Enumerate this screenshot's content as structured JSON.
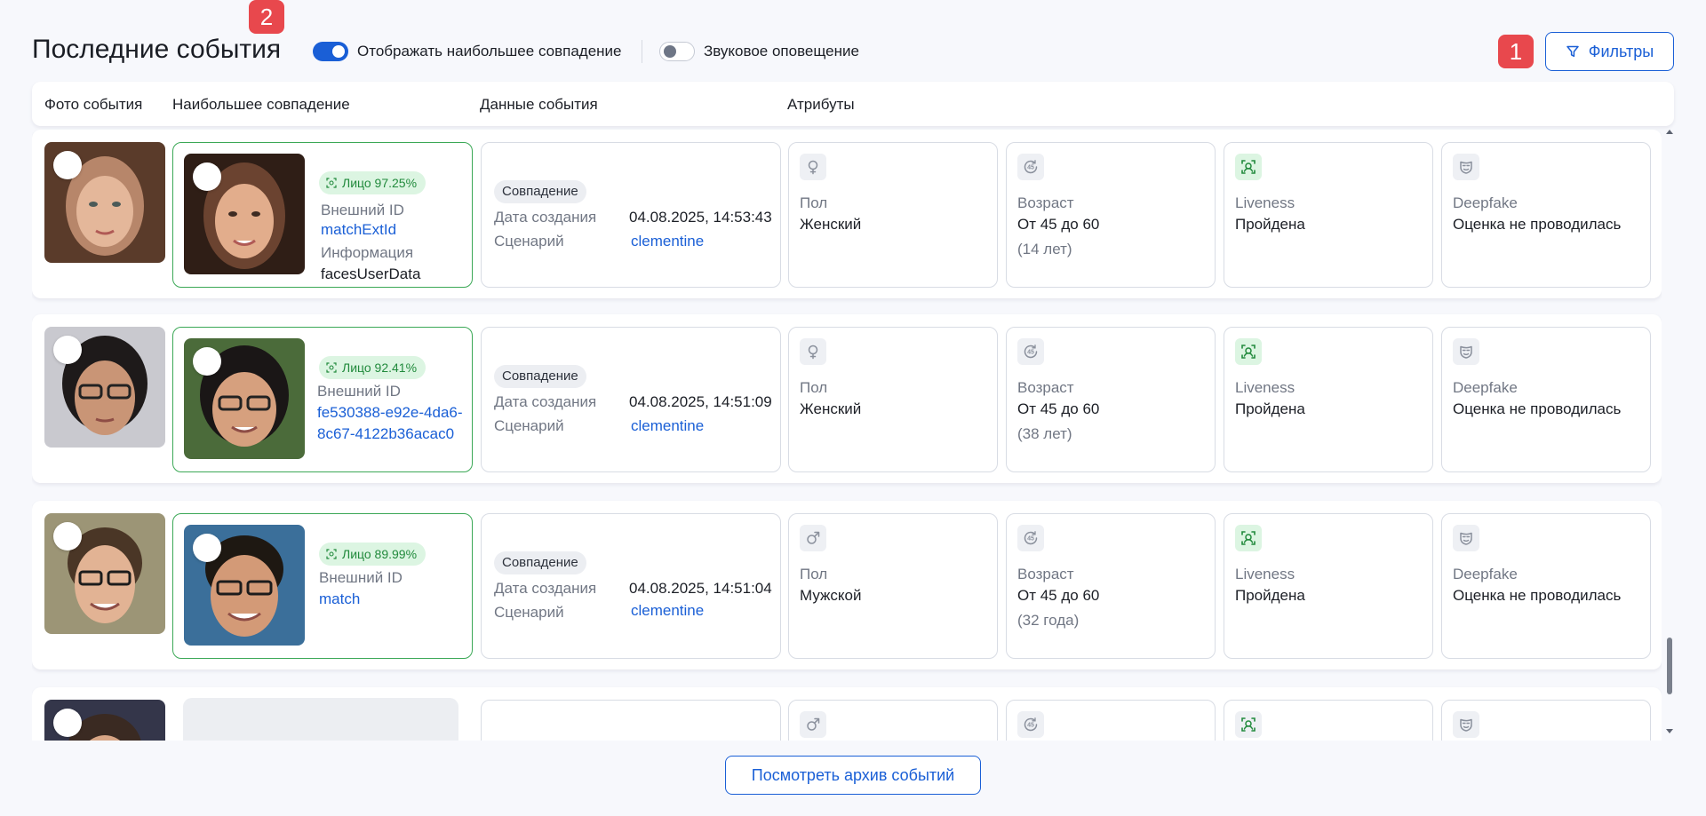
{
  "header": {
    "title": "Последние события",
    "toggle_best_match": {
      "label": "Отображать наибольшее совпадение",
      "state": "on"
    },
    "toggle_sound": {
      "label": "Звуковое оповещение",
      "state": "off"
    },
    "marker_1": "1",
    "marker_2": "2",
    "filters_label": "Фильтры"
  },
  "columns": [
    "Фото события",
    "Наибольшее совпадение",
    "Данные события",
    "Атрибуты"
  ],
  "rows": [
    {
      "face_label": "Лицо 97.25%",
      "ext_id_label": "Внешний ID",
      "ext_id": "matchExtId",
      "info_label": "Информация",
      "info": "facesUserData",
      "event_badge": "Совпадение",
      "created_label": "Дата создания",
      "created": "04.08.2025, 14:53:43",
      "scenario_label": "Сценарий",
      "scenario": "clementine",
      "gender_label": "Пол",
      "gender": "Женский",
      "age_label": "Возраст",
      "age": "От 45 до 60",
      "age_sub": "(14 лет)",
      "liveness_label": "Liveness",
      "liveness": "Пройдена",
      "deepfake_label": "Deepfake",
      "deepfake": "Оценка не проводилась"
    },
    {
      "face_label": "Лицо 92.41%",
      "ext_id_label": "Внешний ID",
      "ext_id": "fe530388-e92e-4da6-8c67-4122b36acac0",
      "event_badge": "Совпадение",
      "created_label": "Дата создания",
      "created": "04.08.2025, 14:51:09",
      "scenario_label": "Сценарий",
      "scenario": "clementine",
      "gender_label": "Пол",
      "gender": "Женский",
      "age_label": "Возраст",
      "age": "От 45 до 60",
      "age_sub": "(38 лет)",
      "liveness_label": "Liveness",
      "liveness": "Пройдена",
      "deepfake_label": "Deepfake",
      "deepfake": "Оценка не проводилась"
    },
    {
      "face_label": "Лицо 89.99%",
      "ext_id_label": "Внешний ID",
      "ext_id": "match",
      "event_badge": "Совпадение",
      "created_label": "Дата создания",
      "created": "04.08.2025, 14:51:04",
      "scenario_label": "Сценарий",
      "scenario": "clementine",
      "gender_label": "Пол",
      "gender": "Мужской",
      "age_label": "Возраст",
      "age": "От 45 до 60",
      "age_sub": "(32 года)",
      "liveness_label": "Liveness",
      "liveness": "Пройдена",
      "deepfake_label": "Deepfake",
      "deepfake": "Оценка не проводилась"
    }
  ],
  "archive_button": "Посмотреть архив событий",
  "colors": {
    "accent": "#1a5fd6",
    "match_border": "#3ba856",
    "marker": "#e8484d"
  }
}
